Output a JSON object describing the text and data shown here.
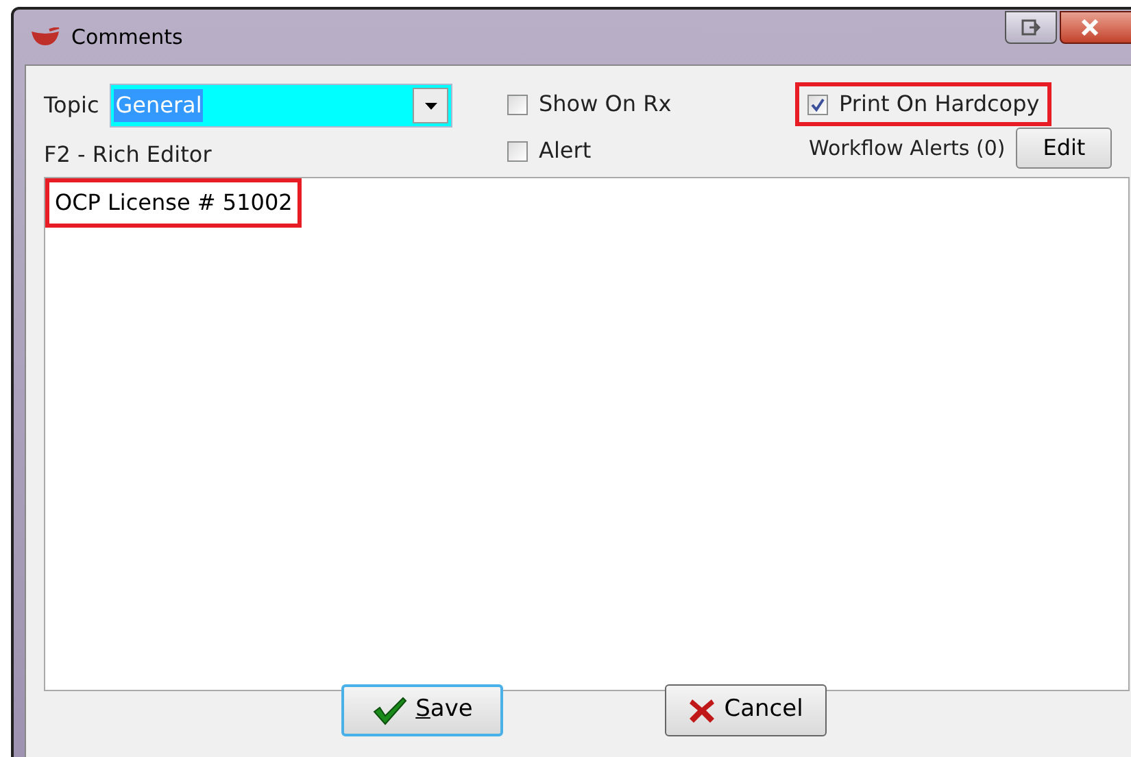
{
  "window": {
    "title": "Comments"
  },
  "topic": {
    "label": "Topic",
    "value": "General"
  },
  "options": [
    {
      "label": "Show On Rx",
      "checked": false
    },
    {
      "label": "Alert",
      "checked": false
    }
  ],
  "print_on_hardcopy": {
    "label": "Print On Hardcopy",
    "checked": true,
    "highlighted": true
  },
  "workflow_alerts": {
    "label": "Workflow Alerts (0)",
    "button": "Edit"
  },
  "editor": {
    "label": "F2 - Rich Editor",
    "text": "OCP License # 51002",
    "highlighted": true
  },
  "buttons": [
    {
      "kind": "save",
      "label": "Save"
    },
    {
      "kind": "cancel",
      "label": "Cancel"
    }
  ]
}
